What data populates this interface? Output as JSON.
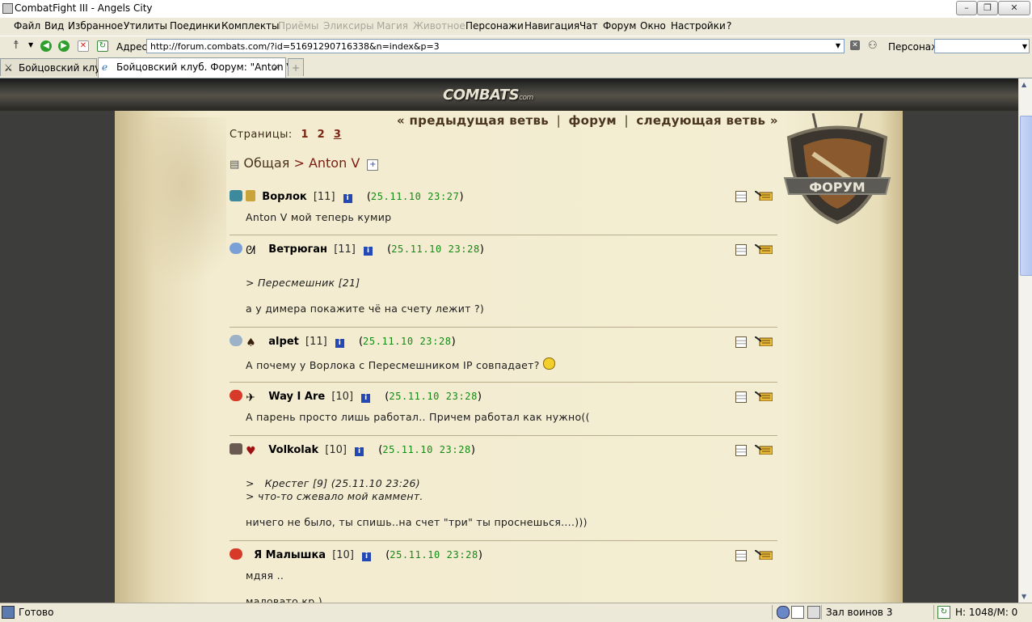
{
  "window": {
    "title": "CombatFight III - Angels City"
  },
  "menu": {
    "items": [
      "Файл",
      "Вид",
      "Избранное",
      "Утилиты",
      "Поединки",
      "Комплекты",
      "Приёмы",
      "Эликсиры",
      "Магия",
      "Животное",
      "Персонажи",
      "Навигация",
      "Чат",
      "Форум",
      "Окно",
      "Настройки",
      "?"
    ]
  },
  "addressbar": {
    "label": "Адрес:",
    "url": "http://forum.combats.com/?id=51691290716338&n=index&p=3",
    "persona_label": "Персонаж:",
    "persona_value": ""
  },
  "tabs": [
    {
      "label": "Бойцовский клуб",
      "active": false
    },
    {
      "label": "Бойцовский клуб. Форум: \"Anton V\"",
      "active": true
    }
  ],
  "site": {
    "logo": "COMBATS",
    "logo_suffix": "com",
    "emblem_label": "ФОРУМ"
  },
  "nav": {
    "prev": "« предыдущая ветвь",
    "forum": "форум",
    "next": "следующая ветвь »",
    "sep": "|"
  },
  "pagination": {
    "label": "Страницы:",
    "pages": [
      "1",
      "2",
      "3"
    ],
    "current": "3"
  },
  "breadcrumb": {
    "section": "Общая",
    "topic": "> Anton V"
  },
  "posts": [
    {
      "nick": "Ворлок",
      "level": "[11]",
      "date": "25.11.10 23:27",
      "lines": [
        {
          "text": "Anton V мой теперь кумир",
          "quote": false
        }
      ]
    },
    {
      "nick": "Ветрюган",
      "level": "[11]",
      "date": "25.11.10 23:28",
      "lines": [
        {
          "text": "",
          "quote": false
        },
        {
          "text": "> Пересмешник [21]",
          "quote": true
        },
        {
          "text": "",
          "quote": false
        },
        {
          "text": "а у димера покажите чё на счету лежит ?)",
          "quote": false
        }
      ]
    },
    {
      "nick": "alpet",
      "level": "[11]",
      "date": "25.11.10 23:28",
      "lines": [
        {
          "text": "А почему у Ворлока с Пересмешником IP совпадает?",
          "quote": false
        }
      ]
    },
    {
      "nick": "Way I Are",
      "level": "[10]",
      "date": "25.11.10 23:28",
      "lines": [
        {
          "text": "А парень просто лишь работал.. Причем работал как нужно((",
          "quote": false
        }
      ]
    },
    {
      "nick": "Volkolak",
      "level": "[10]",
      "date": "25.11.10 23:28",
      "lines": [
        {
          "text": "",
          "quote": false
        },
        {
          "text": ">   Крестег [9] (25.11.10 23:26)",
          "quote": true
        },
        {
          "text": "> что-то сжевало мой каммент.",
          "quote": true
        },
        {
          "text": "",
          "quote": false
        },
        {
          "text": "ничего не было, ты спишь..на счет \"три\" ты проснешься....)))",
          "quote": false
        }
      ]
    },
    {
      "nick": "Я Малышка",
      "level": "[10]",
      "date": "25.11.10 23:28",
      "lines": [
        {
          "text": "мдяя ..",
          "quote": false
        },
        {
          "text": "",
          "quote": false
        },
        {
          "text": "маловато кр )",
          "quote": false
        }
      ]
    }
  ],
  "status": {
    "left": "Готово",
    "room": "Зал воинов 3",
    "hp": "H: 1048/M: 0"
  },
  "colors": {
    "link_brown": "#4a3520",
    "topic_red": "#7a1d10",
    "date_green": "#138a13",
    "parchment": "#f3edd3",
    "page_bg": "#3d3d3c"
  }
}
